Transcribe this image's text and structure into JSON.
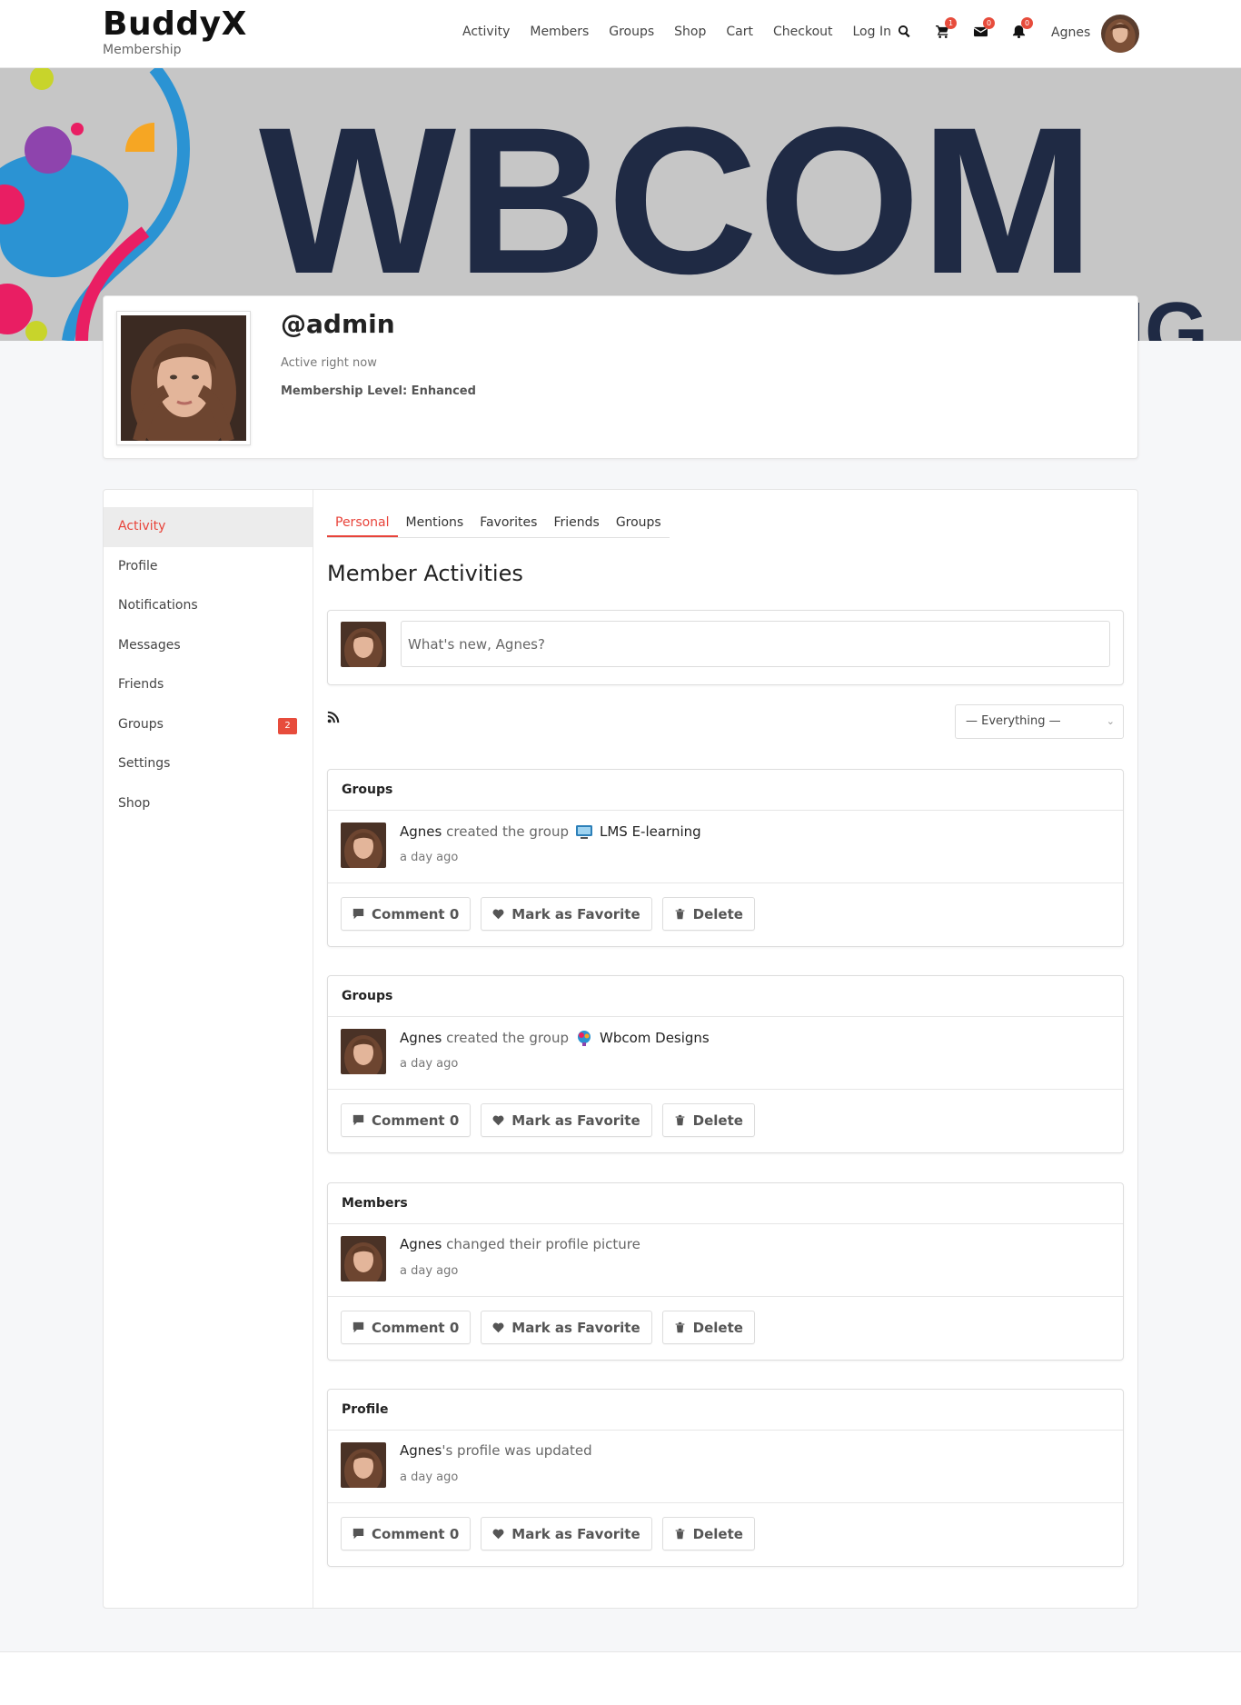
{
  "header": {
    "site_title": "BuddyX",
    "tagline": "Membership",
    "nav": [
      "Activity",
      "Members",
      "Groups",
      "Shop",
      "Cart",
      "Checkout",
      "Log In"
    ],
    "cart_count": "1",
    "messages_count": "0",
    "notifications_count": "0",
    "user_name": "Agnes"
  },
  "cover": {
    "brand_text": "WBCOM",
    "brand_sub": "DESIG"
  },
  "profile": {
    "handle": "@admin",
    "status": "Active right now",
    "membership": "Membership Level: Enhanced"
  },
  "sidebar": {
    "items": [
      {
        "label": "Activity"
      },
      {
        "label": "Profile"
      },
      {
        "label": "Notifications"
      },
      {
        "label": "Messages"
      },
      {
        "label": "Friends"
      },
      {
        "label": "Groups",
        "badge": "2"
      },
      {
        "label": "Settings"
      },
      {
        "label": "Shop"
      }
    ]
  },
  "subtabs": [
    "Personal",
    "Mentions",
    "Favorites",
    "Friends",
    "Groups"
  ],
  "main": {
    "title": "Member Activities",
    "whats_new_placeholder": "What's new, Agnes?",
    "filter_value": "— Everything —"
  },
  "activities": [
    {
      "type": "Groups",
      "who": "Agnes",
      "action": "created the group",
      "target": "LMS E-learning",
      "time": "a day ago"
    },
    {
      "type": "Groups",
      "who": "Agnes",
      "action": "created the group",
      "target": "Wbcom Designs",
      "time": "a day ago"
    },
    {
      "type": "Members",
      "who": "Agnes",
      "action": "changed their profile picture",
      "target": "",
      "time": "a day ago"
    },
    {
      "type": "Profile",
      "who": "Agnes",
      "action": "'s profile was updated",
      "target": "",
      "time": "a day ago"
    }
  ],
  "actions": {
    "comment": "Comment 0",
    "favorite": "Mark as Favorite",
    "delete": "Delete"
  },
  "colors": {
    "accent": "#e8433a",
    "cover_bg": "#c6c6c6",
    "brand_navy": "#1f2a44"
  }
}
